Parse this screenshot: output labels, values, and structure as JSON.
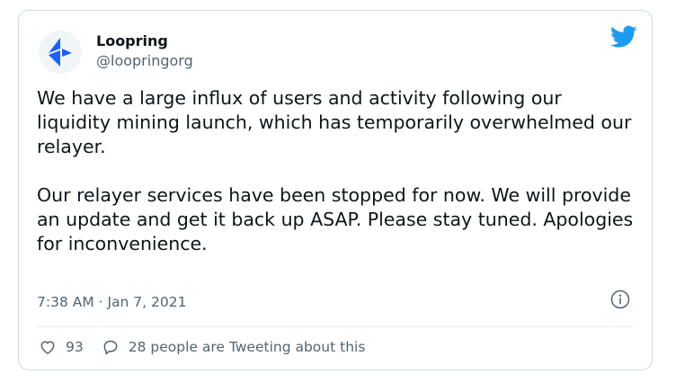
{
  "tweet": {
    "author_name": "Loopring",
    "author_handle": "@loopringorg",
    "paragraphs": [
      "We have a large influx of users and activity following our liquidity mining launch, which has temporarily overwhelmed our relayer.",
      "Our relayer services have been stopped for now. We will provide an update and get it back up ASAP. Please stay tuned. Apologies for inconvenience."
    ],
    "timestamp": "7:38 AM · Jan 7, 2021",
    "like_count": "93",
    "discussion_label": "28 people are Tweeting about this"
  },
  "icons": {
    "avatar": "loopring-logo",
    "brand": "twitter-bird-icon",
    "info": "info-icon",
    "like": "heart-icon",
    "reply": "speech-bubble-icon"
  },
  "colors": {
    "twitter_blue": "#1d9bf0",
    "loopring_blue": "#1c60ff",
    "text": "#0f1419",
    "muted": "#536471",
    "border": "#cfd9de"
  }
}
